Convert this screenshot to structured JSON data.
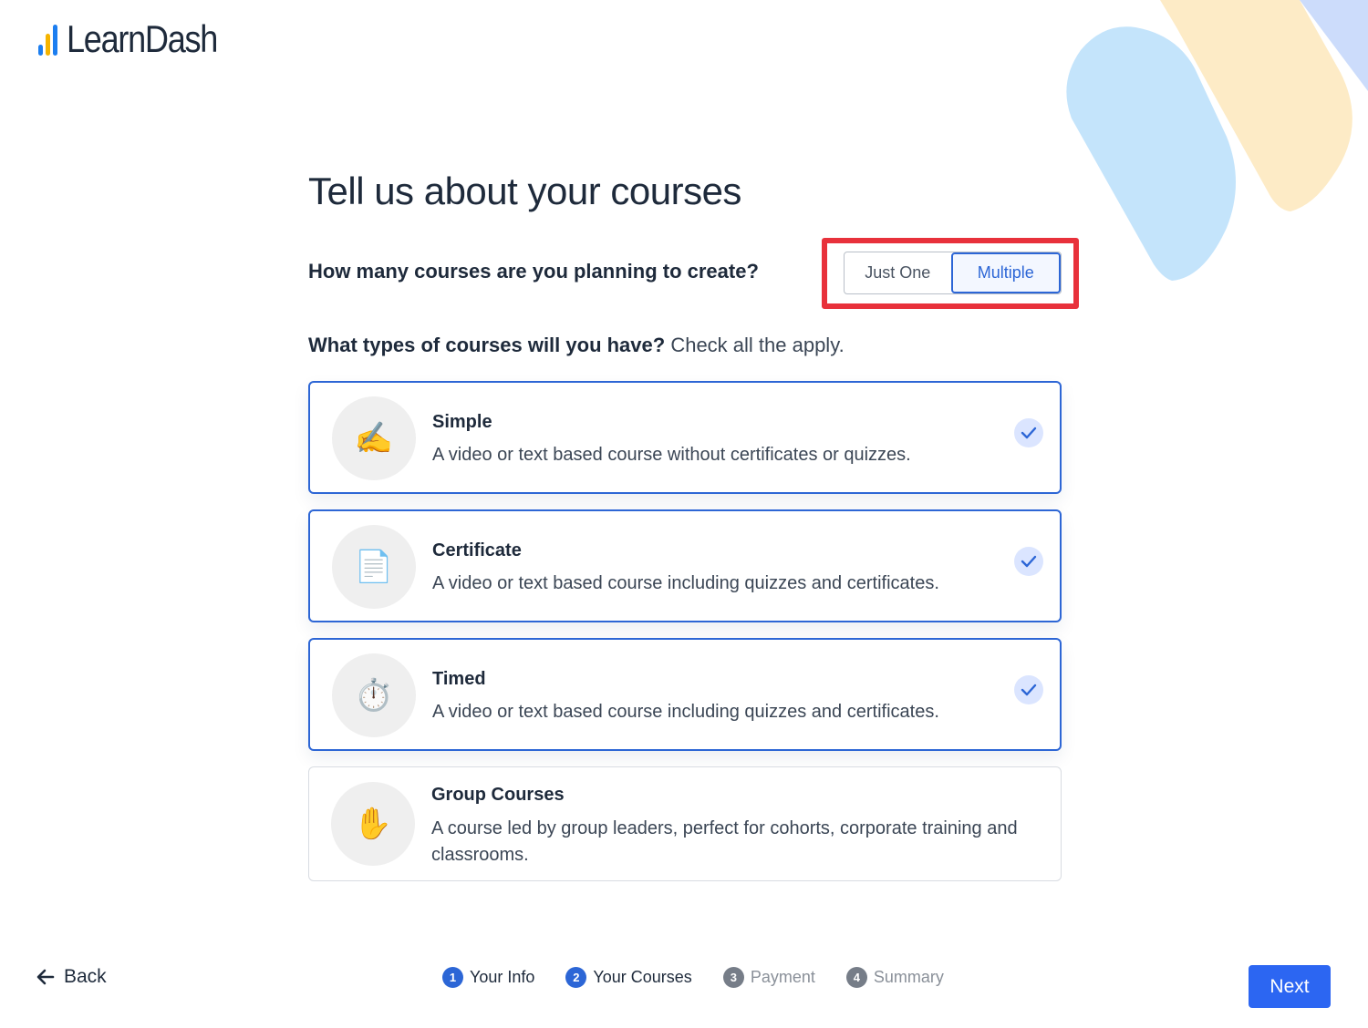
{
  "brand": {
    "name": "LearnDash",
    "bar_colors": [
      "#1c7ef0",
      "#f5b400",
      "#1c7ef0"
    ],
    "accent": "#2c66d6",
    "highlight": "#e8313b"
  },
  "page": {
    "title": "Tell us about your courses"
  },
  "course_count": {
    "question": "How many courses are you planning to create?",
    "options": [
      "Just One",
      "Multiple"
    ],
    "selected": "Multiple"
  },
  "course_types": {
    "question_bold": "What types of courses will you have?",
    "question_hint": " Check all the apply.",
    "items": [
      {
        "icon": "writing-hand-icon",
        "glyph": "✍️",
        "title": "Simple",
        "description": "A video or text based course without certificates or quizzes.",
        "selected": true
      },
      {
        "icon": "document-icon",
        "glyph": "📄",
        "title": "Certificate",
        "description": "A video or text based course including quizzes and certificates.",
        "selected": true
      },
      {
        "icon": "stopwatch-icon",
        "glyph": "⏱️",
        "title": "Timed",
        "description": "A video or text based course including quizzes and certificates.",
        "selected": true
      },
      {
        "icon": "raised-hand-icon",
        "glyph": "✋",
        "title": "Group Courses",
        "description": "A course led by group leaders, perfect for cohorts, corporate training and classrooms.",
        "selected": false
      }
    ]
  },
  "footer": {
    "back_label": "Back",
    "next_label": "Next",
    "steps": [
      {
        "num": "1",
        "label": "Your Info",
        "state": "done"
      },
      {
        "num": "2",
        "label": "Your Courses",
        "state": "done"
      },
      {
        "num": "3",
        "label": "Payment",
        "state": "todo"
      },
      {
        "num": "4",
        "label": "Summary",
        "state": "todo"
      }
    ]
  }
}
